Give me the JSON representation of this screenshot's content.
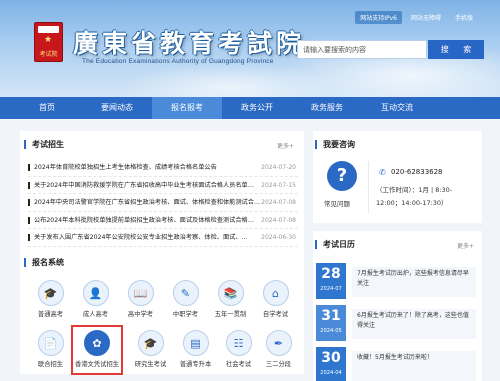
{
  "header": {
    "logo_text": "考试院",
    "title": "廣東省教育考試院",
    "subtitle": "The Education Examinations Authority of Guangdong Province",
    "top_links": [
      "网站支持IPv6",
      "网站无障碍",
      "手机版"
    ],
    "search_placeholder": "请输入要搜索的内容",
    "search_button": "搜 索"
  },
  "nav": {
    "items": [
      "首页",
      "要闻动态",
      "报名报考",
      "政务公开",
      "政务服务",
      "互动交流"
    ],
    "active": "报名报考"
  },
  "exam_enroll": {
    "title": "考试招生",
    "more": "更多+",
    "news": [
      {
        "title": "2024年体育院校单独招生上考生体格检查、成绩考核合格名单公告",
        "date": "2024-07-20"
      },
      {
        "title": "关于2024年中国消防救援学院在广东省招收高中毕业生考核面试合格人员名单…",
        "date": "2024-07-15"
      },
      {
        "title": "2024年中央司法警官学院在广东省招生政治考核、面试、体格检查和体能测试合…",
        "date": "2024-07-08"
      },
      {
        "title": "公布2024年本科批院校单独提前单招招生政治考核、面试及体格检查测试合格…",
        "date": "2024-07-08"
      },
      {
        "title": "关于发布入围广东省2024年公安院校公安专业招生政治考察、体检、面试、…",
        "date": "2024-06-30"
      }
    ]
  },
  "registration": {
    "title": "报名系统",
    "items": [
      {
        "label": "普通高考",
        "icon": "graduation-cap-icon",
        "glyph": "🎓"
      },
      {
        "label": "成人高考",
        "icon": "person-icon",
        "glyph": "👤"
      },
      {
        "label": "高中学考",
        "icon": "book-icon",
        "glyph": "📖"
      },
      {
        "label": "中职学考",
        "icon": "pencil-icon",
        "glyph": "✎"
      },
      {
        "label": "五年一贯制",
        "icon": "books-icon",
        "glyph": "📚"
      },
      {
        "label": "自学考试",
        "icon": "desk-icon",
        "glyph": "⌂"
      },
      {
        "label": "联合招生",
        "icon": "document-icon",
        "glyph": "📄"
      },
      {
        "label": "香港文凭试招生",
        "icon": "bauhinia-icon",
        "glyph": "✿"
      },
      {
        "label": "研究生考试",
        "icon": "mortarboard-icon",
        "glyph": "🎓"
      },
      {
        "label": "普通专升本",
        "icon": "open-book-icon",
        "glyph": "▤"
      },
      {
        "label": "社会考试",
        "icon": "clipboard-icon",
        "glyph": "☷"
      },
      {
        "label": "三二分段",
        "icon": "pen-icon",
        "glyph": "✒"
      }
    ]
  },
  "consult": {
    "title": "我要咨询",
    "faq_label": "常见问题",
    "phone": "020-62833628",
    "hours_line1": "（工作时间）：1月 | 8:30-",
    "hours_line2": "12:00；14:00-17:30）"
  },
  "calendar": {
    "title": "考试日历",
    "more": "更多+",
    "items": [
      {
        "day": "28",
        "ym": "2024-07",
        "text": "7月报生考试历出炉，这些报考信息请尽早关注"
      },
      {
        "day": "31",
        "ym": "2024-05",
        "text": "6月报生考试历来了！除了高考，这些也值得关注"
      },
      {
        "day": "30",
        "ym": "2024-04",
        "text": "收藏！5月报生考试历来啦！"
      }
    ]
  },
  "colors": {
    "primary": "#2a69c4",
    "highlight_border": "#e53935"
  }
}
